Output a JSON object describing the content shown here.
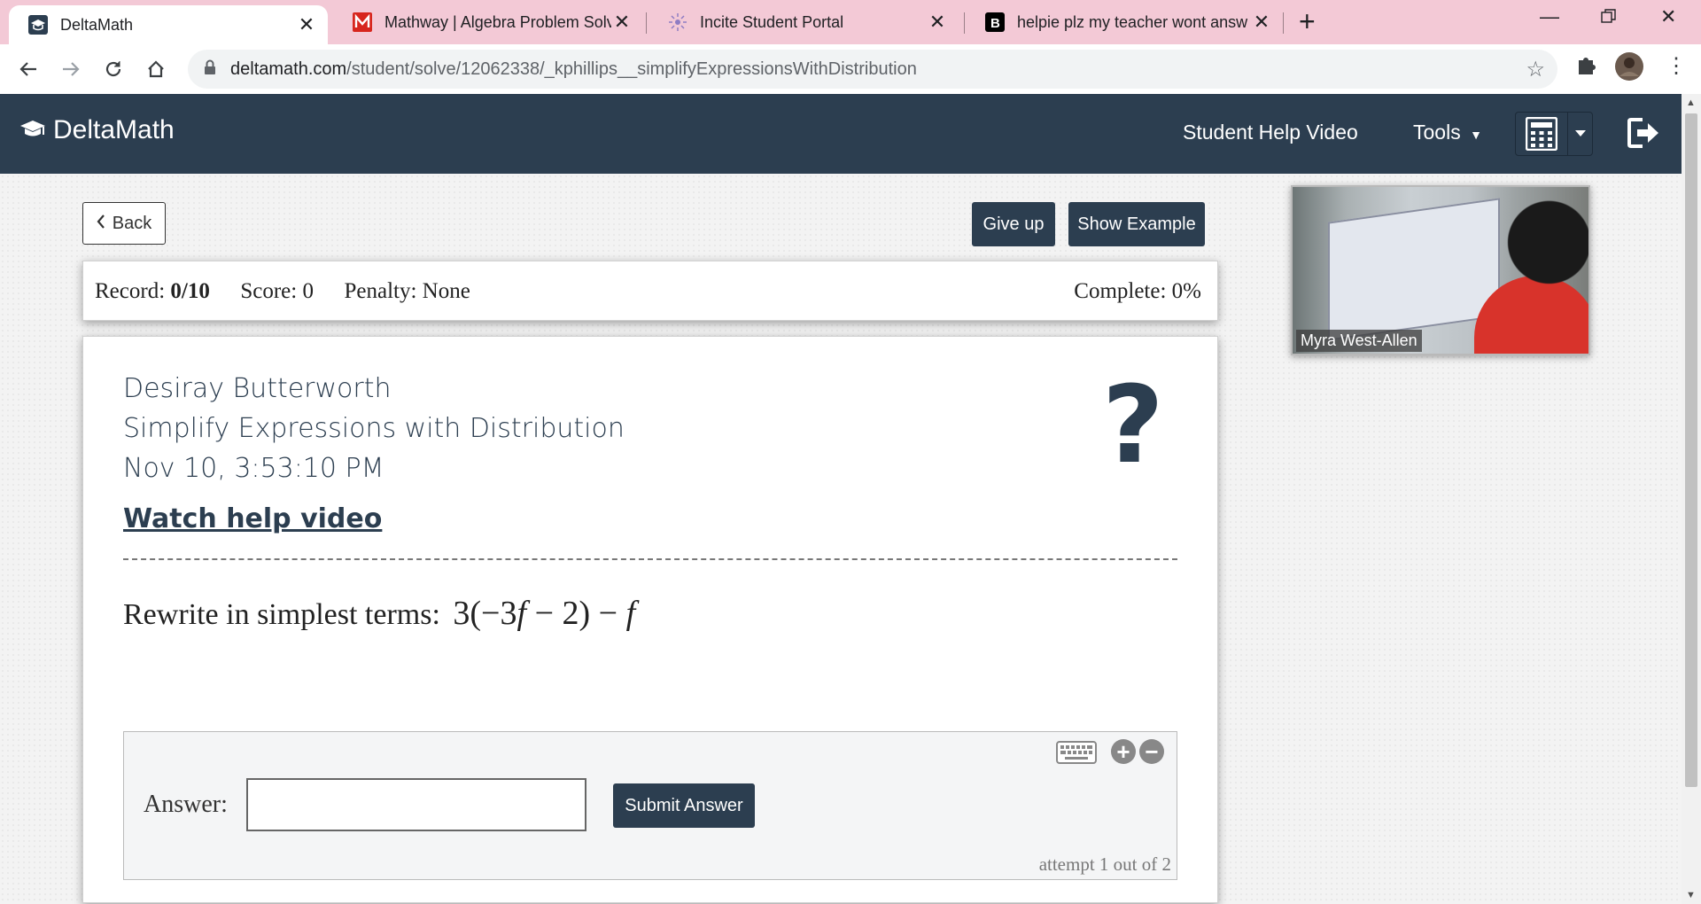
{
  "browser": {
    "tabs": [
      {
        "title": "DeltaMath",
        "active": true
      },
      {
        "title": "Mathway | Algebra Problem Solv",
        "active": false
      },
      {
        "title": "Incite Student Portal",
        "active": false
      },
      {
        "title": "helpie plz my teacher wont answ",
        "active": false
      }
    ],
    "url_host": "deltamath.com",
    "url_path": "/student/solve/12062338/_kphillips__simplifyExpressionsWithDistribution"
  },
  "nav": {
    "logo": "DeltaMath",
    "help_video": "Student Help Video",
    "tools": "Tools"
  },
  "actions": {
    "back": "Back",
    "give_up": "Give up",
    "show_example": "Show Example"
  },
  "record": {
    "record_label": "Record:",
    "record_value": "0/10",
    "score": "Score: 0",
    "penalty": "Penalty: None",
    "complete": "Complete: 0%"
  },
  "problem": {
    "student_name": "Desiray Butterworth",
    "topic": "Simplify Expressions with Distribution",
    "timestamp": "Nov 10, 3:53:10 PM",
    "help_link": "Watch help video",
    "question_text": "Rewrite in simplest terms:",
    "expression_lead": "3(−3",
    "expression_var1": "f",
    "expression_mid": " − 2) − ",
    "expression_var2": "f",
    "answer_label": "Answer:",
    "answer_value": "",
    "submit": "Submit Answer",
    "attempt": "attempt 1 out of 2"
  },
  "video": {
    "participant": "Myra West-Allen"
  }
}
